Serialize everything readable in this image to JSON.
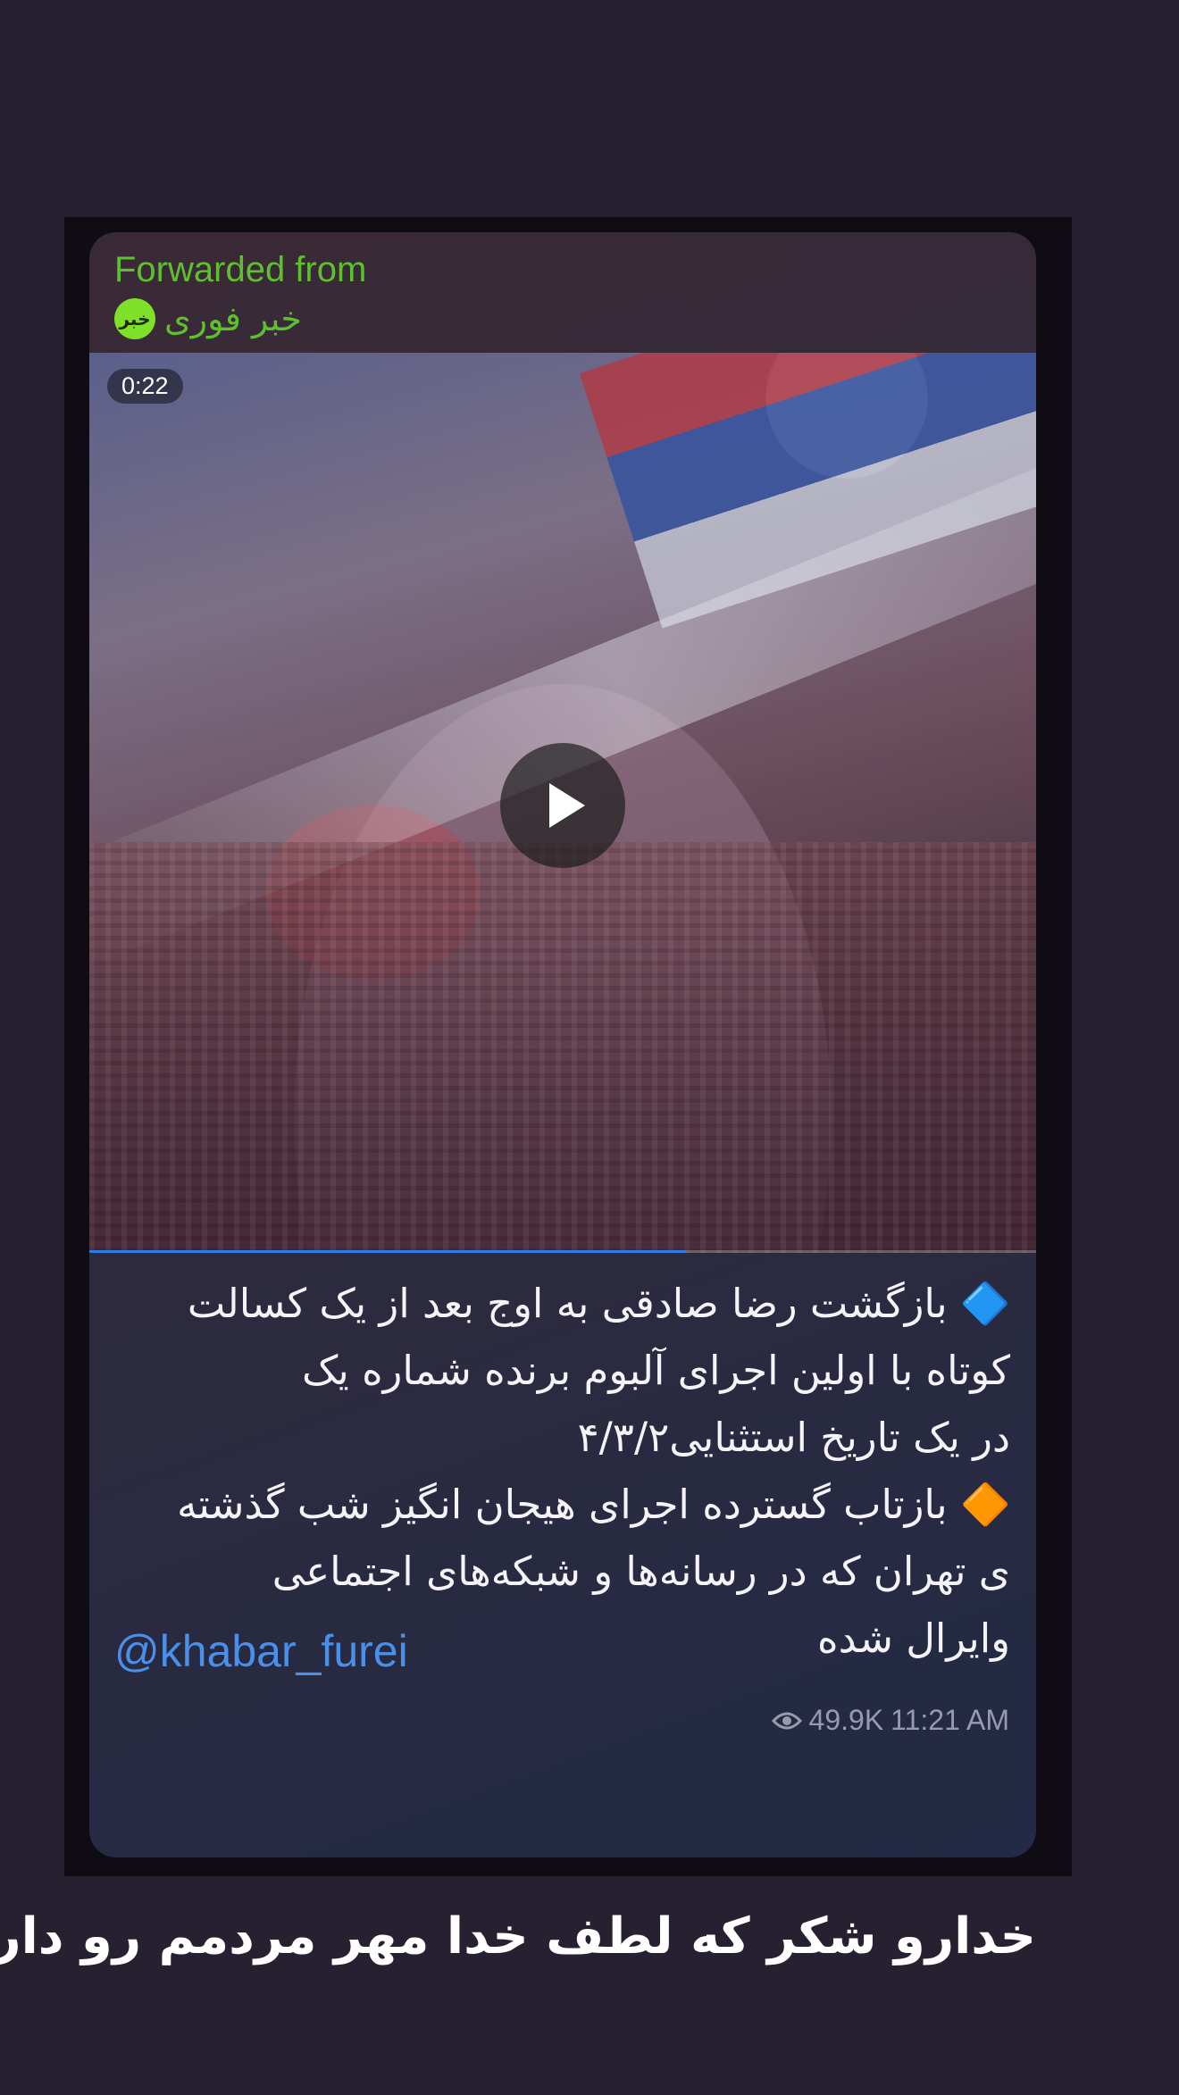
{
  "message": {
    "forwarded_label": "Forwarded from",
    "channel_name": "خبر فوری",
    "channel_avatar_text": "خبر",
    "video": {
      "duration": "0:22",
      "progress": 0.63
    },
    "caption_lines": [
      "🔷 بازگشت رضا صادقی به اوج بعد از یک کسالت",
      " کوتاه با اولین اجرای آلبوم برنده شماره یک",
      "در یک تاریخ استثنایی۴/۳/۲",
      "🔶 بازتاب گسترده اجرای هیجان انگیز شب گذشته",
      " ی تهران که در رسانه‌ها و شبکه‌های اجتماعی",
      "وایرال شده"
    ],
    "mention": "@khabar_furei",
    "views": "49.9K",
    "time": "11:21 AM"
  },
  "story_caption": "خدارو شکر که لطف خدا مهر مردمم رو دارم",
  "colors": {
    "background": "#272030",
    "forwarded_text": "#5fbf2f",
    "link": "#4a8fe8",
    "progress": "#2b7ee8"
  }
}
